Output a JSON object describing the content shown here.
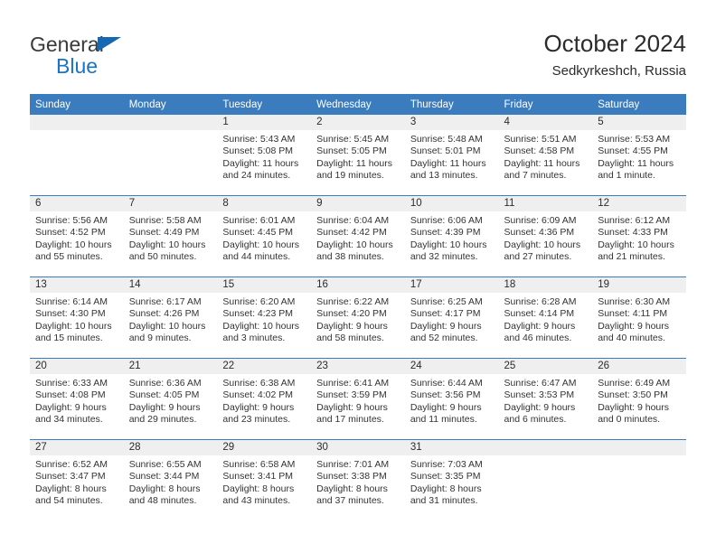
{
  "logo": {
    "word1": "General",
    "word2": "Blue",
    "triangle_color": "#1768b0",
    "blue_color": "#1a73c4"
  },
  "header": {
    "title": "October 2024",
    "subtitle": "Sedkyrkeshch, Russia",
    "accent_color": "#3a7cbe",
    "band_color": "#efefef"
  },
  "weekdays": [
    "Sunday",
    "Monday",
    "Tuesday",
    "Wednesday",
    "Thursday",
    "Friday",
    "Saturday"
  ],
  "labels": {
    "sunrise_prefix": "Sunrise:",
    "sunset_prefix": "Sunset:",
    "daylight_prefix": "Daylight:"
  },
  "weeks": [
    [
      {
        "day": "",
        "empty": true
      },
      {
        "day": "",
        "empty": true
      },
      {
        "day": "1",
        "sunrise": "Sunrise: 5:43 AM",
        "sunset": "Sunset: 5:08 PM",
        "daylight_l1": "Daylight: 11 hours",
        "daylight_l2": "and 24 minutes."
      },
      {
        "day": "2",
        "sunrise": "Sunrise: 5:45 AM",
        "sunset": "Sunset: 5:05 PM",
        "daylight_l1": "Daylight: 11 hours",
        "daylight_l2": "and 19 minutes."
      },
      {
        "day": "3",
        "sunrise": "Sunrise: 5:48 AM",
        "sunset": "Sunset: 5:01 PM",
        "daylight_l1": "Daylight: 11 hours",
        "daylight_l2": "and 13 minutes."
      },
      {
        "day": "4",
        "sunrise": "Sunrise: 5:51 AM",
        "sunset": "Sunset: 4:58 PM",
        "daylight_l1": "Daylight: 11 hours",
        "daylight_l2": "and 7 minutes."
      },
      {
        "day": "5",
        "sunrise": "Sunrise: 5:53 AM",
        "sunset": "Sunset: 4:55 PM",
        "daylight_l1": "Daylight: 11 hours",
        "daylight_l2": "and 1 minute."
      }
    ],
    [
      {
        "day": "6",
        "sunrise": "Sunrise: 5:56 AM",
        "sunset": "Sunset: 4:52 PM",
        "daylight_l1": "Daylight: 10 hours",
        "daylight_l2": "and 55 minutes."
      },
      {
        "day": "7",
        "sunrise": "Sunrise: 5:58 AM",
        "sunset": "Sunset: 4:49 PM",
        "daylight_l1": "Daylight: 10 hours",
        "daylight_l2": "and 50 minutes."
      },
      {
        "day": "8",
        "sunrise": "Sunrise: 6:01 AM",
        "sunset": "Sunset: 4:45 PM",
        "daylight_l1": "Daylight: 10 hours",
        "daylight_l2": "and 44 minutes."
      },
      {
        "day": "9",
        "sunrise": "Sunrise: 6:04 AM",
        "sunset": "Sunset: 4:42 PM",
        "daylight_l1": "Daylight: 10 hours",
        "daylight_l2": "and 38 minutes."
      },
      {
        "day": "10",
        "sunrise": "Sunrise: 6:06 AM",
        "sunset": "Sunset: 4:39 PM",
        "daylight_l1": "Daylight: 10 hours",
        "daylight_l2": "and 32 minutes."
      },
      {
        "day": "11",
        "sunrise": "Sunrise: 6:09 AM",
        "sunset": "Sunset: 4:36 PM",
        "daylight_l1": "Daylight: 10 hours",
        "daylight_l2": "and 27 minutes."
      },
      {
        "day": "12",
        "sunrise": "Sunrise: 6:12 AM",
        "sunset": "Sunset: 4:33 PM",
        "daylight_l1": "Daylight: 10 hours",
        "daylight_l2": "and 21 minutes."
      }
    ],
    [
      {
        "day": "13",
        "sunrise": "Sunrise: 6:14 AM",
        "sunset": "Sunset: 4:30 PM",
        "daylight_l1": "Daylight: 10 hours",
        "daylight_l2": "and 15 minutes."
      },
      {
        "day": "14",
        "sunrise": "Sunrise: 6:17 AM",
        "sunset": "Sunset: 4:26 PM",
        "daylight_l1": "Daylight: 10 hours",
        "daylight_l2": "and 9 minutes."
      },
      {
        "day": "15",
        "sunrise": "Sunrise: 6:20 AM",
        "sunset": "Sunset: 4:23 PM",
        "daylight_l1": "Daylight: 10 hours",
        "daylight_l2": "and 3 minutes."
      },
      {
        "day": "16",
        "sunrise": "Sunrise: 6:22 AM",
        "sunset": "Sunset: 4:20 PM",
        "daylight_l1": "Daylight: 9 hours",
        "daylight_l2": "and 58 minutes."
      },
      {
        "day": "17",
        "sunrise": "Sunrise: 6:25 AM",
        "sunset": "Sunset: 4:17 PM",
        "daylight_l1": "Daylight: 9 hours",
        "daylight_l2": "and 52 minutes."
      },
      {
        "day": "18",
        "sunrise": "Sunrise: 6:28 AM",
        "sunset": "Sunset: 4:14 PM",
        "daylight_l1": "Daylight: 9 hours",
        "daylight_l2": "and 46 minutes."
      },
      {
        "day": "19",
        "sunrise": "Sunrise: 6:30 AM",
        "sunset": "Sunset: 4:11 PM",
        "daylight_l1": "Daylight: 9 hours",
        "daylight_l2": "and 40 minutes."
      }
    ],
    [
      {
        "day": "20",
        "sunrise": "Sunrise: 6:33 AM",
        "sunset": "Sunset: 4:08 PM",
        "daylight_l1": "Daylight: 9 hours",
        "daylight_l2": "and 34 minutes."
      },
      {
        "day": "21",
        "sunrise": "Sunrise: 6:36 AM",
        "sunset": "Sunset: 4:05 PM",
        "daylight_l1": "Daylight: 9 hours",
        "daylight_l2": "and 29 minutes."
      },
      {
        "day": "22",
        "sunrise": "Sunrise: 6:38 AM",
        "sunset": "Sunset: 4:02 PM",
        "daylight_l1": "Daylight: 9 hours",
        "daylight_l2": "and 23 minutes."
      },
      {
        "day": "23",
        "sunrise": "Sunrise: 6:41 AM",
        "sunset": "Sunset: 3:59 PM",
        "daylight_l1": "Daylight: 9 hours",
        "daylight_l2": "and 17 minutes."
      },
      {
        "day": "24",
        "sunrise": "Sunrise: 6:44 AM",
        "sunset": "Sunset: 3:56 PM",
        "daylight_l1": "Daylight: 9 hours",
        "daylight_l2": "and 11 minutes."
      },
      {
        "day": "25",
        "sunrise": "Sunrise: 6:47 AM",
        "sunset": "Sunset: 3:53 PM",
        "daylight_l1": "Daylight: 9 hours",
        "daylight_l2": "and 6 minutes."
      },
      {
        "day": "26",
        "sunrise": "Sunrise: 6:49 AM",
        "sunset": "Sunset: 3:50 PM",
        "daylight_l1": "Daylight: 9 hours",
        "daylight_l2": "and 0 minutes."
      }
    ],
    [
      {
        "day": "27",
        "sunrise": "Sunrise: 6:52 AM",
        "sunset": "Sunset: 3:47 PM",
        "daylight_l1": "Daylight: 8 hours",
        "daylight_l2": "and 54 minutes."
      },
      {
        "day": "28",
        "sunrise": "Sunrise: 6:55 AM",
        "sunset": "Sunset: 3:44 PM",
        "daylight_l1": "Daylight: 8 hours",
        "daylight_l2": "and 48 minutes."
      },
      {
        "day": "29",
        "sunrise": "Sunrise: 6:58 AM",
        "sunset": "Sunset: 3:41 PM",
        "daylight_l1": "Daylight: 8 hours",
        "daylight_l2": "and 43 minutes."
      },
      {
        "day": "30",
        "sunrise": "Sunrise: 7:01 AM",
        "sunset": "Sunset: 3:38 PM",
        "daylight_l1": "Daylight: 8 hours",
        "daylight_l2": "and 37 minutes."
      },
      {
        "day": "31",
        "sunrise": "Sunrise: 7:03 AM",
        "sunset": "Sunset: 3:35 PM",
        "daylight_l1": "Daylight: 8 hours",
        "daylight_l2": "and 31 minutes."
      },
      {
        "day": "",
        "empty": true
      },
      {
        "day": "",
        "empty": true
      }
    ]
  ]
}
